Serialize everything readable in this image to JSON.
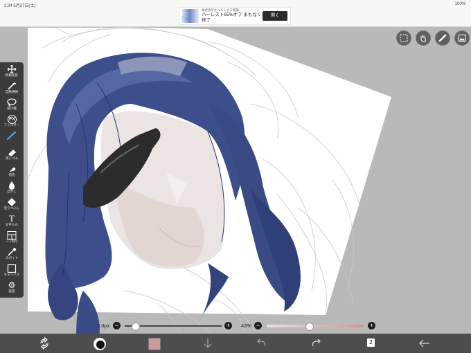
{
  "status_bar": {
    "left_text": "2:34  5月27日(土)",
    "right_text": "100%"
  },
  "ad": {
    "company": "株式会社オルリンクス製薬",
    "headline": "ハーレスト65%オフ まもなく終了",
    "button_label": "開く",
    "info_icon": "info-icon",
    "close_icon": "close-icon"
  },
  "tools": [
    {
      "name": "move-transform",
      "label": "移動変形",
      "icon": "move-arrows-icon"
    },
    {
      "name": "auto-select",
      "label": "自動選択",
      "icon": "magic-wand-icon"
    },
    {
      "name": "lasso",
      "label": "投げ縄",
      "icon": "lasso-icon"
    },
    {
      "name": "filter",
      "label": "フィルター",
      "icon": "fx-icon",
      "glyph": "FX"
    },
    {
      "name": "brush",
      "label": "",
      "icon": "brush-icon",
      "active": true
    },
    {
      "name": "eraser",
      "label": "消しゴム",
      "icon": "eraser-icon"
    },
    {
      "name": "smudge",
      "label": "指先",
      "icon": "finger-icon"
    },
    {
      "name": "blur",
      "label": "ぼかし",
      "icon": "droplet-icon"
    },
    {
      "name": "fill",
      "label": "塗りつぶし",
      "icon": "bucket-icon"
    },
    {
      "name": "text",
      "label": "文字入れ",
      "icon": "text-icon",
      "glyph": "T"
    },
    {
      "name": "frame",
      "label": "コマ割り",
      "icon": "frame-divider-icon"
    },
    {
      "name": "eyedropper",
      "label": "スポイト",
      "icon": "eyedropper-icon"
    },
    {
      "name": "canvas",
      "label": "キャンバス",
      "icon": "canvas-icon"
    },
    {
      "name": "settings",
      "label": "設定",
      "icon": "gear-icon"
    }
  ],
  "top_right_buttons": [
    {
      "name": "selection-button",
      "icon": "selection-icon"
    },
    {
      "name": "hand-button",
      "icon": "hand-icon"
    },
    {
      "name": "ruler-button",
      "icon": "ruler-icon"
    },
    {
      "name": "material-button",
      "icon": "image-icon"
    }
  ],
  "brush_slider": {
    "label": "3.0px",
    "value": 0.08,
    "minus": "−",
    "plus": "+"
  },
  "opacity_slider": {
    "label": "43%",
    "value": 0.43,
    "minus": "−",
    "plus": "+"
  },
  "bottom_bar": {
    "transform_icon": "transform-rotate-icon",
    "brush_preview": "brush-preview-icon",
    "color_swatch": "#c89a9a",
    "download_icon": "down-arrow-icon",
    "undo_icon": "undo-icon",
    "redo_icon": "redo-icon",
    "layers_count": "2",
    "back_icon": "back-arrow-icon"
  }
}
